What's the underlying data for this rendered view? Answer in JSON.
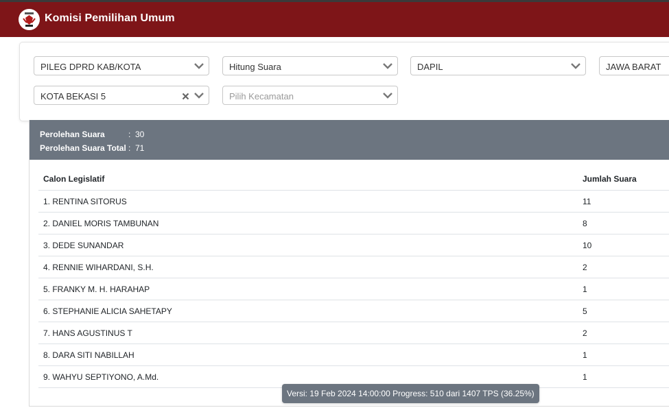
{
  "header": {
    "title": "Komisi Pemilihan Umum"
  },
  "filters": {
    "election_type": "PILEG DPRD KAB/KOTA",
    "mode": "Hitung Suara",
    "level": "DAPIL",
    "province": "JAWA BARAT",
    "dapil": "KOTA BEKASI 5",
    "kecamatan_placeholder": "Pilih Kecamatan"
  },
  "summary": {
    "votes_label": "Perolehan Suara",
    "votes_value": "30",
    "total_label": "Perolehan Suara Total",
    "total_value": "71",
    "colon": ":"
  },
  "table": {
    "headers": [
      "Calon Legislatif",
      "Jumlah Suara"
    ],
    "rows": [
      {
        "name": "1. RENTINA SITORUS",
        "votes": "11"
      },
      {
        "name": "2. DANIEL MORIS TAMBUNAN",
        "votes": "8"
      },
      {
        "name": "3. DEDE SUNANDAR",
        "votes": "10"
      },
      {
        "name": "4. RENNIE WIHARDANI, S.H.",
        "votes": "2"
      },
      {
        "name": "5. FRANKY M. H. HARAHAP",
        "votes": "1"
      },
      {
        "name": "6. STEPHANIE ALICIA SAHETAPY",
        "votes": "5"
      },
      {
        "name": "7. HANS AGUSTINUS T",
        "votes": "2"
      },
      {
        "name": "8. DARA SITI NABILLAH",
        "votes": "1"
      },
      {
        "name": "9. WAHYU SEPTIYONO, A.Md.",
        "votes": "1"
      }
    ]
  },
  "footer": {
    "version": "Versi: 19 Feb 2024 14:00:00 Progress: 510 dari 1407 TPS (36.25%)"
  },
  "colors": {
    "header_bg": "#7e1518",
    "summary_bg": "#6c7580"
  }
}
